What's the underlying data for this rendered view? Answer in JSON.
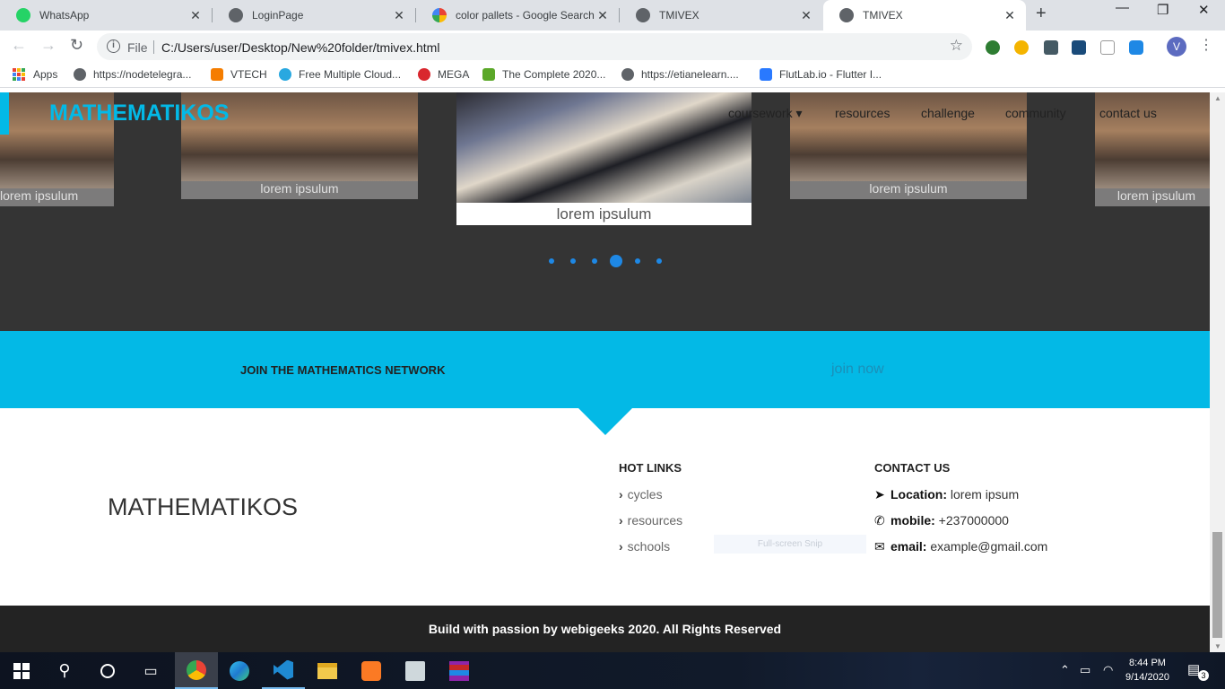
{
  "tabs": [
    {
      "title": "WhatsApp",
      "icon": "whatsapp-icon",
      "color": "#25d366"
    },
    {
      "title": "LoginPage",
      "icon": "globe-icon",
      "color": "#5f6368"
    },
    {
      "title": "color pallets - Google Search",
      "icon": "google-icon",
      "color": "#4285f4"
    },
    {
      "title": "TMIVEX",
      "icon": "globe-icon",
      "color": "#5f6368"
    },
    {
      "title": "TMIVEX",
      "icon": "globe-icon",
      "color": "#5f6368"
    }
  ],
  "address": {
    "scheme_label": "File",
    "url": "C:/Users/user/Desktop/New%20folder/tmivex.html"
  },
  "profile": {
    "initial": "V"
  },
  "bookmarks": [
    {
      "label": "Apps",
      "icon": "apps-grid-icon"
    },
    {
      "label": "https://nodetelegra...",
      "icon": "globe-icon"
    },
    {
      "label": "VTECH",
      "icon": "blogger-icon"
    },
    {
      "label": "Free Multiple Cloud...",
      "icon": "cloud-icon"
    },
    {
      "label": "MEGA",
      "icon": "mega-icon"
    },
    {
      "label": "The Complete 2020...",
      "icon": "udemy-icon"
    },
    {
      "label": "https://etianelearn....",
      "icon": "globe-icon"
    },
    {
      "label": "FlutLab.io - Flutter I...",
      "icon": "flutlab-icon"
    }
  ],
  "site": {
    "brand": "MATHEMATIKOS",
    "nav": [
      {
        "label": "coursework ▾"
      },
      {
        "label": "resources"
      },
      {
        "label": "challenge"
      },
      {
        "label": "community"
      },
      {
        "label": "contact us"
      }
    ],
    "carousel": {
      "captions": [
        "lorem ipsulum",
        "lorem ipsulum",
        "lorem ipsulum",
        "lorem ipsulum",
        "lorem ipsulum"
      ],
      "active_dot": 4,
      "dot_count": 6
    },
    "join": {
      "title": "JOIN THE MATHEMATICS NETWORK",
      "cta": "join now"
    },
    "footer": {
      "brand": "MATHEMATIKOS",
      "hot_links_title": "HOT LINKS",
      "hot_links": [
        "cycles",
        "resources",
        "schools"
      ],
      "contact_title": "CONTACT US",
      "contact": {
        "location_label": "Location:",
        "location_value": "lorem ipsum",
        "mobile_label": "mobile:",
        "mobile_value": "+237000000",
        "email_label": "email:",
        "email_value": "example@gmail.com"
      },
      "overlay_text": "Full-screen Snip",
      "copyright": "Build with passion by webigeeks 2020. All Rights Reserved"
    }
  },
  "taskbar": {
    "time": "8:44 PM",
    "date": "9/14/2020",
    "notifications": "3"
  },
  "colors": {
    "accent": "#03b9e6",
    "hero_bg": "#343434",
    "footer_bg": "#232323"
  }
}
